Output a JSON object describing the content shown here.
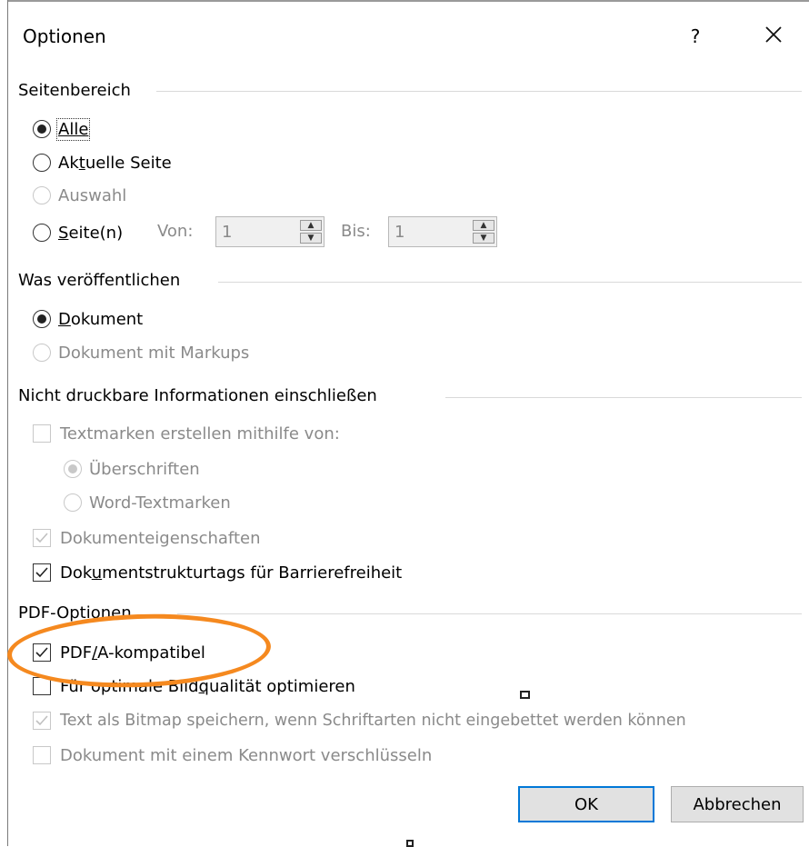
{
  "dialog": {
    "title": "Optionen",
    "help": "?",
    "close_icon": "close-icon"
  },
  "seitenbereich": {
    "heading": "Seitenbereich",
    "alle": "Alle",
    "aktuelle_pre": "Ak",
    "aktuelle_u": "t",
    "aktuelle_post": "uelle Seite",
    "auswahl": "Auswahl",
    "seiten_u": "S",
    "seiten_post": "eite(n)",
    "von_label": "Von:",
    "von_value": "1",
    "bis_label": "Bis:",
    "bis_value": "1"
  },
  "veroeffentlichen": {
    "heading": "Was veröffentlichen",
    "dokument_u": "D",
    "dokument_post": "okument",
    "markups": "Dokument mit Markups"
  },
  "nichtdruckbar": {
    "heading": "Nicht druckbare Informationen einschließen",
    "textmarken": "Textmarken erstellen mithilfe von:",
    "ueberschriften": "Überschriften",
    "wordtextmarken": "Word-Textmarken",
    "eigenschaften": "Dokumenteigenschaften",
    "struktur_pre": "Dok",
    "struktur_u": "u",
    "struktur_post": "mentstrukturtags für Barrierefreiheit"
  },
  "pdf": {
    "heading": "PDF-Optionen",
    "pdfa_pre": "PDF",
    "pdfa_u": "/",
    "pdfa_post": "A-kompatibel",
    "bild_pre": "Für optimale Bild",
    "bild_u": "q",
    "bild_post": "ualität optimieren",
    "bitmap": "Text als Bitmap speichern, wenn Schriftarten nicht eingebettet werden können",
    "kennwort": "Dokument mit einem Kennwort verschlüsseln"
  },
  "buttons": {
    "ok": "OK",
    "cancel": "Abbrechen"
  },
  "colors": {
    "highlight_ellipse": "#f5891f",
    "default_button_border": "#0078d7"
  }
}
